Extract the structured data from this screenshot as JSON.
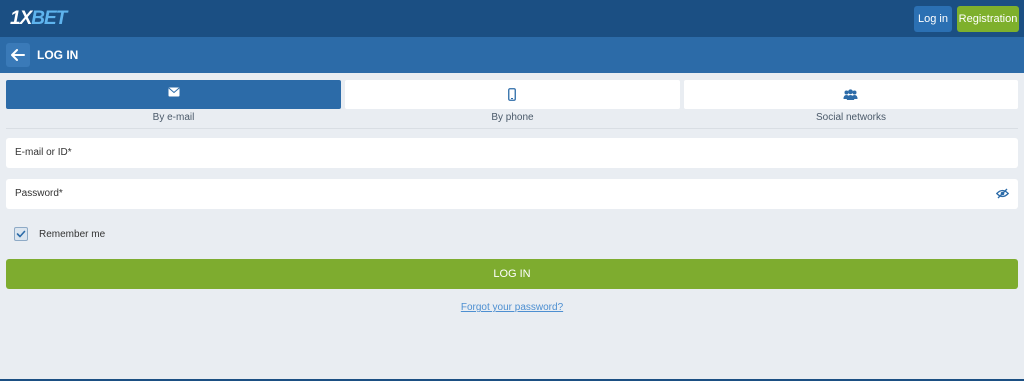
{
  "header": {
    "logo_main": "1X",
    "logo_accent": "BET",
    "login_label": "Log in",
    "register_label": "Registration"
  },
  "subheader": {
    "title": "LOG IN"
  },
  "tabs": [
    {
      "label": "By e-mail",
      "icon": "envelope-icon",
      "active": true
    },
    {
      "label": "By phone",
      "icon": "phone-icon",
      "active": false
    },
    {
      "label": "Social networks",
      "icon": "users-icon",
      "active": false
    }
  ],
  "form": {
    "email_placeholder": "E-mail or ID*",
    "password_placeholder": "Password*",
    "remember_label": "Remember me",
    "remember_checked": true,
    "submit_label": "LOG IN",
    "forgot_label": "Forgot your password?"
  },
  "colors": {
    "header_bg": "#1b4f83",
    "subheader_bg": "#2c6ba8",
    "accent_green": "#7eac2f",
    "link_blue": "#4d8fd1",
    "page_bg": "#e9edf2"
  }
}
